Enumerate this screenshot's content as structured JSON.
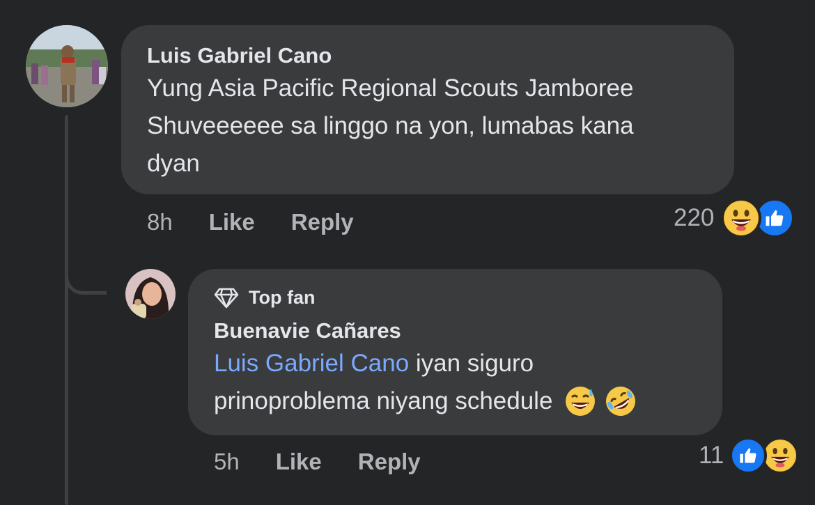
{
  "comment": {
    "author": "Luis Gabriel Cano",
    "text_line1": "Yung Asia Pacific Regional Scouts Jamboree",
    "text_line2": "Shuveeeeee sa linggo na yon, lumabas kana",
    "text_line3": "dyan",
    "time": "8h",
    "like_label": "Like",
    "reply_label": "Reply",
    "reaction_count": "220",
    "reactions": [
      "grin-emoji",
      "like-icon"
    ]
  },
  "reply": {
    "badge": "Top fan",
    "author": "Buenavie Cañares",
    "mention": "Luis Gabriel Cano",
    "text_line1": " iyan siguro",
    "text_line2": "prinoproblema niyang schedule ",
    "emojis": [
      "sweat-smile-emoji",
      "rofl-emoji"
    ],
    "time": "5h",
    "like_label": "Like",
    "reply_label": "Reply",
    "reaction_count": "11",
    "reactions": [
      "like-icon",
      "grin-emoji"
    ]
  },
  "colors": {
    "background": "#242526",
    "bubble": "#3a3b3c",
    "mention": "#7aa9ff",
    "like_blue": "#1877f2",
    "emoji_yellow": "#f7b928"
  }
}
